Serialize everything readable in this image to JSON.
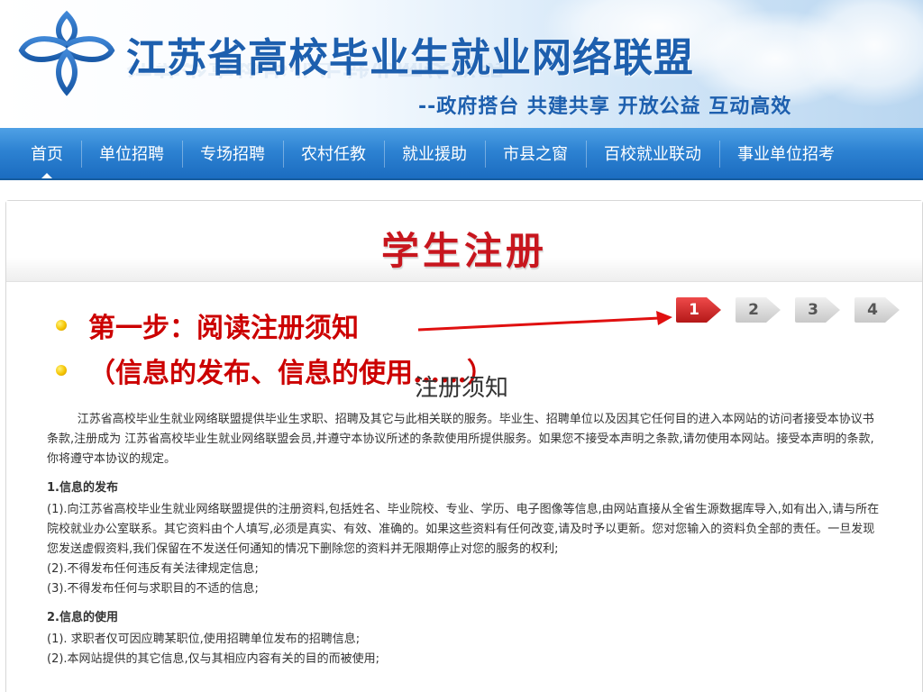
{
  "header": {
    "site_title": "江苏省高校毕业生就业网络联盟",
    "slogan": "--政府搭台 共建共享 开放公益 互动高效"
  },
  "nav": {
    "items": [
      "首页",
      "单位招聘",
      "专场招聘",
      "农村任教",
      "就业援助",
      "市县之窗",
      "百校就业联动",
      "事业单位招考"
    ],
    "active_index": 0
  },
  "page": {
    "title": "学生注册"
  },
  "annotation": {
    "step1": "第一步：阅读注册须知",
    "step1_detail": "（信息的发布、信息的使用……）"
  },
  "steps": {
    "labels": [
      "1",
      "2",
      "3",
      "4"
    ],
    "current": 1
  },
  "notice": {
    "title": "注册须知",
    "intro": "江苏省高校毕业生就业网络联盟提供毕业生求职、招聘及其它与此相关联的服务。毕业生、招聘单位以及因其它任何目的进入本网站的访问者接受本协议书条款,注册成为 江苏省高校毕业生就业网络联盟会员,并遵守本协议所述的条款使用所提供服务。如果您不接受本声明之条款,请勿使用本网站。接受本声明的条款,你将遵守本协议的规定。",
    "section1_title": "1.信息的发布",
    "section1_items": [
      "(1).向江苏省高校毕业生就业网络联盟提供的注册资料,包括姓名、毕业院校、专业、学历、电子图像等信息,由网站直接从全省生源数据库导入,如有出入,请与所在院校就业办公室联系。其它资料由个人填写,必须是真实、有效、准确的。如果这些资料有任何改变,请及时予以更新。您对您输入的资料负全部的责任。一旦发现您发送虚假资料,我们保留在不发送任何通知的情况下删除您的资料并无限期停止对您的服务的权利;",
      "(2).不得发布任何违反有关法律规定信息;",
      "(3).不得发布任何与求职目的不适的信息;"
    ],
    "section2_title": "2.信息的使用",
    "section2_items": [
      "(1). 求职者仅可因应聘某职位,使用招聘单位发布的招聘信息;",
      "(2).本网站提供的其它信息,仅与其相应内容有关的目的而被使用;"
    ]
  },
  "colors": {
    "nav_bg": "#2d82d2",
    "brand_blue": "#1d5fae",
    "title_red": "#c8161e",
    "annotation_red": "#cc0000",
    "step_active": "#d12a2a",
    "step_inactive": "#dcdcdc"
  }
}
